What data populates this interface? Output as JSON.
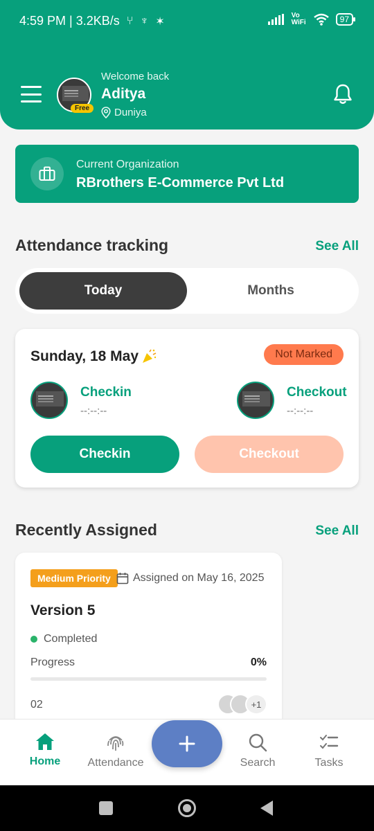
{
  "status_bar": {
    "left": "4:59 PM | 3.2KB/s",
    "network": "Vo WiFi",
    "battery": "97"
  },
  "header": {
    "welcome": "Welcome back",
    "user_name": "Aditya",
    "location": "Duniya",
    "plan_badge": "Free"
  },
  "organization": {
    "label": "Current Organization",
    "name": "RBrothers E-Commerce Pvt Ltd"
  },
  "attendance": {
    "section_title": "Attendance tracking",
    "see_all": "See All",
    "tabs": [
      {
        "label": "Today",
        "active": true
      },
      {
        "label": "Months",
        "active": false
      }
    ],
    "date": "Sunday, 18 May",
    "status_badge": "Not Marked",
    "checkin_label": "Checkin",
    "checkin_time": "--:--:--",
    "checkout_label": "Checkout",
    "checkout_time": "--:--:--",
    "checkin_button": "Checkin",
    "checkout_button": "Checkout"
  },
  "recent": {
    "section_title": "Recently Assigned",
    "see_all": "See All",
    "task": {
      "priority": "Medium Priority",
      "assigned_on": "Assigned on May 16, 2025",
      "title": "Version 5",
      "status": "Completed",
      "progress_label": "Progress",
      "progress_value": "0%",
      "progress_fraction": 0,
      "number": "02",
      "more_members": "+1"
    }
  },
  "bottom_nav": {
    "items": [
      {
        "label": "Home",
        "icon": "home-icon",
        "active": true
      },
      {
        "label": "Attendance",
        "icon": "fingerprint-icon",
        "active": false
      },
      {
        "label": "Search",
        "icon": "search-icon",
        "active": false
      },
      {
        "label": "Tasks",
        "icon": "tasks-icon",
        "active": false
      }
    ],
    "fab_icon": "plus-icon"
  },
  "colors": {
    "primary": "#07a07c",
    "fab": "#5d7fc5",
    "priority": "#f49f1c",
    "not_marked": "#ff7a4d"
  }
}
